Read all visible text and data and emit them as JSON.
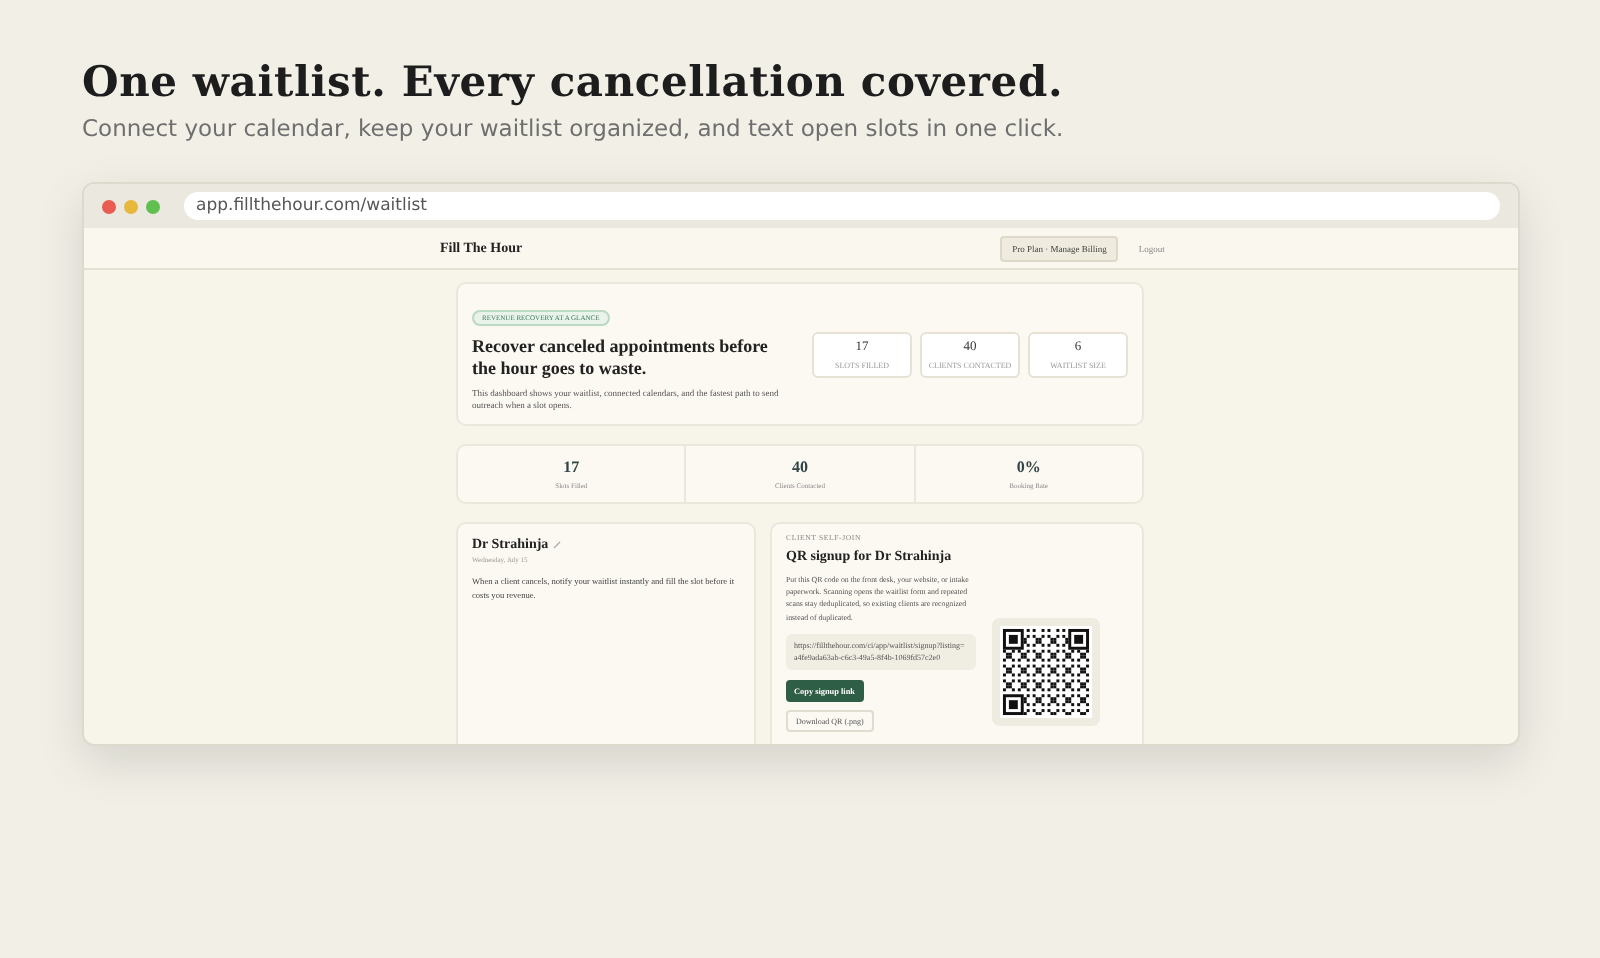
{
  "hero": {
    "title": "One waitlist. Every cancellation covered.",
    "subtitle": "Connect your calendar, keep your waitlist organized, and text open slots in one click."
  },
  "browser": {
    "url": "app.fillthehour.com/waitlist"
  },
  "nav": {
    "brand": "Fill The Hour",
    "plan_button": "Pro Plan · Manage Billing",
    "logout": "Logout"
  },
  "summary": {
    "badge": "REVENUE RECOVERY AT A GLANCE",
    "title": "Recover canceled appointments before the hour goes to waste.",
    "description": "This dashboard shows your waitlist, connected calendars, and the fastest path to send outreach when a slot opens.",
    "stats": [
      {
        "value": "17",
        "label": "SLOTS FILLED"
      },
      {
        "value": "40",
        "label": "CLIENTS CONTACTED"
      },
      {
        "value": "6",
        "label": "WAITLIST SIZE"
      }
    ]
  },
  "metrics": [
    {
      "value": "17",
      "label": "Slots Filled"
    },
    {
      "value": "40",
      "label": "Clients Contacted"
    },
    {
      "value": "0%",
      "label": "Booking Rate"
    }
  ],
  "profile": {
    "name": "Dr Strahinja",
    "date": "Wednesday, July 15",
    "text": "When a client cancels, notify your waitlist instantly and fill the slot before it costs you revenue."
  },
  "signup": {
    "eyebrow": "CLIENT SELF-JOIN",
    "title": "QR signup for Dr Strahinja",
    "text": "Put this QR code on the front desk, your website, or intake paperwork. Scanning opens the waitlist form and repeated scans stay deduplicated, so existing clients are recognized instead of duplicated.",
    "link": "https://fillthehour.com/ci/app/waitlist/signup?listing=a4fe9ada63ab-c6c3-49a5-8f4b-1069fd57c2e0",
    "copy_button": "Copy signup link",
    "download_button": "Download QR (.png)"
  }
}
